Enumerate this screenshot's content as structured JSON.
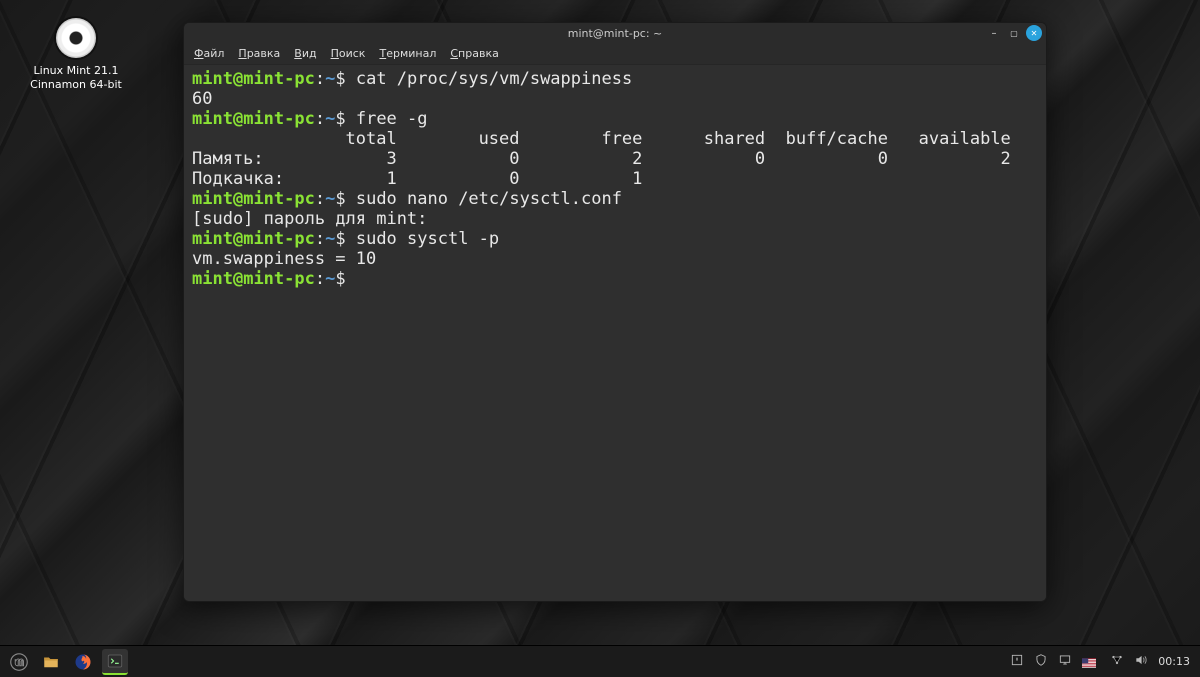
{
  "desktop": {
    "icon_label_line1": "Linux Mint 21.1",
    "icon_label_line2": "Cinnamon 64-bit"
  },
  "window": {
    "title": "mint@mint-pc: ~",
    "menu": {
      "file": "Файл",
      "edit": "Правка",
      "view": "Вид",
      "search": "Поиск",
      "terminal": "Терминал",
      "help": "Справка"
    }
  },
  "prompt": {
    "user": "mint",
    "host": "mint-pc",
    "path": "~",
    "sym": "$"
  },
  "terminal": {
    "cmd1": "cat /proc/sys/vm/swappiness",
    "out1": "60",
    "cmd2": "free -g",
    "free_header": "               total        used        free      shared  buff/cache   available",
    "free_mem": "Память:            3           0           2           0           0           2",
    "free_swap": "Подкачка:          1           0           1",
    "cmd3": "sudo nano /etc/sysctl.conf",
    "sudo_prompt": "[sudo] пароль для mint:",
    "cmd4": "sudo sysctl -p",
    "out4": "vm.swappiness = 10"
  },
  "taskbar": {
    "clock": "00:13"
  }
}
